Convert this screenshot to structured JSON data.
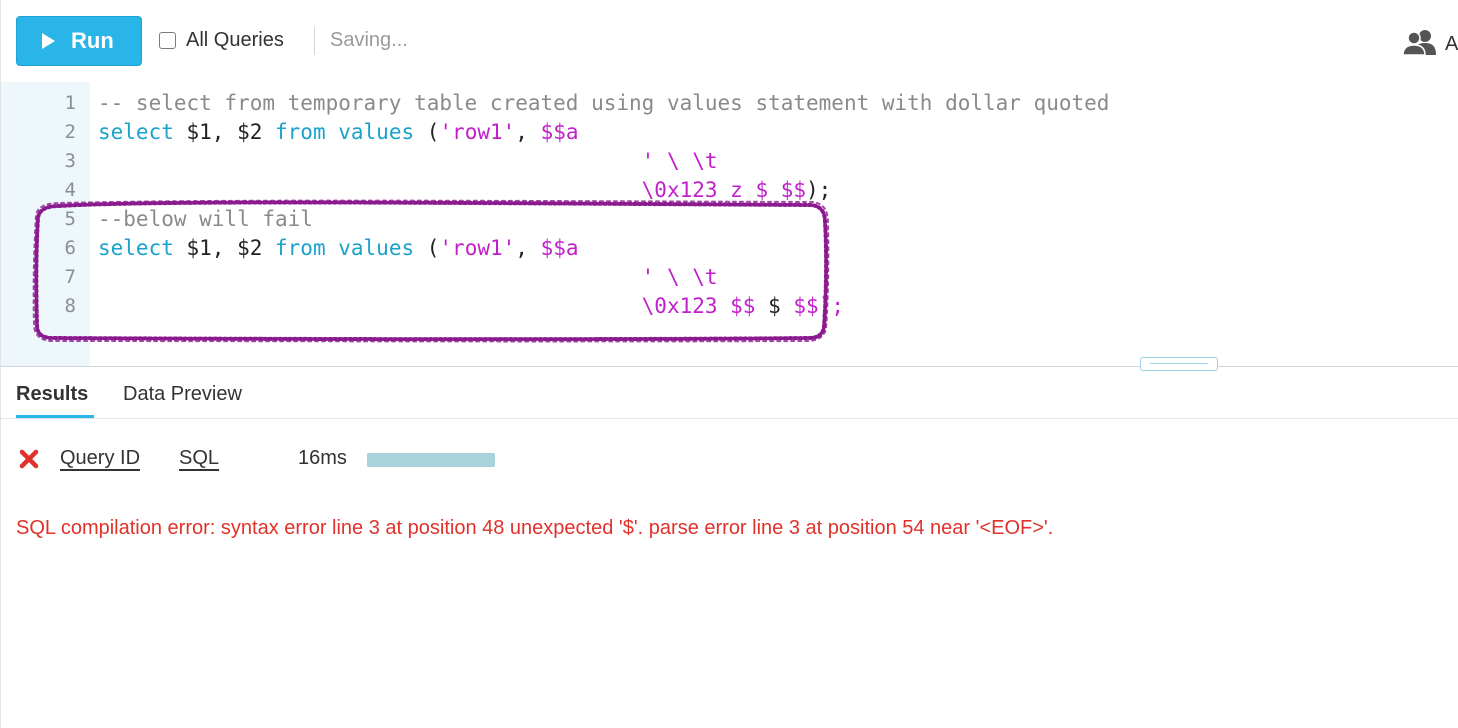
{
  "toolbar": {
    "run_label": "Run",
    "all_queries_label": "All Queries",
    "all_queries_checked": false,
    "status": "Saving...",
    "user_initial": "A",
    "run_icon": "play-icon",
    "user_icon": "users-icon"
  },
  "editor": {
    "lines": [
      {
        "n": "1",
        "tokens": [
          {
            "t": "-- select from temporary table created using values statement with dollar quoted",
            "c": "cm"
          }
        ]
      },
      {
        "n": "2",
        "tokens": [
          {
            "t": "select",
            "c": "kw"
          },
          {
            "t": " $1, $2 ",
            "c": "pl"
          },
          {
            "t": "from",
            "c": "kw"
          },
          {
            "t": " ",
            "c": "pl"
          },
          {
            "t": "values",
            "c": "kw"
          },
          {
            "t": " (",
            "c": "pl"
          },
          {
            "t": "'row1'",
            "c": "st"
          },
          {
            "t": ", ",
            "c": "pl"
          },
          {
            "t": "$$a",
            "c": "st"
          }
        ]
      },
      {
        "n": "3",
        "tokens": [
          {
            "t": "                                           ' \\ \\t",
            "c": "st"
          }
        ]
      },
      {
        "n": "4",
        "tokens": [
          {
            "t": "                                           \\0x123 z $ $$",
            "c": "st"
          },
          {
            "t": ");",
            "c": "pl"
          }
        ]
      },
      {
        "n": "5",
        "tokens": [
          {
            "t": "--below will fail",
            "c": "cm"
          }
        ]
      },
      {
        "n": "6",
        "tokens": [
          {
            "t": "select",
            "c": "kw"
          },
          {
            "t": " $1, $2 ",
            "c": "pl"
          },
          {
            "t": "from",
            "c": "kw"
          },
          {
            "t": " ",
            "c": "pl"
          },
          {
            "t": "values",
            "c": "kw"
          },
          {
            "t": " (",
            "c": "pl"
          },
          {
            "t": "'row1'",
            "c": "st"
          },
          {
            "t": ", ",
            "c": "pl"
          },
          {
            "t": "$$a",
            "c": "st"
          }
        ]
      },
      {
        "n": "7",
        "tokens": [
          {
            "t": "                                           ' \\ \\t",
            "c": "st"
          }
        ]
      },
      {
        "n": "8",
        "tokens": [
          {
            "t": "                                           \\0x123 $$",
            "c": "st"
          },
          {
            "t": " $ ",
            "c": "pl"
          },
          {
            "t": "$$);",
            "c": "st"
          }
        ]
      }
    ]
  },
  "results": {
    "tabs": [
      {
        "label": "Results",
        "active": true
      },
      {
        "label": "Data Preview",
        "active": false
      }
    ],
    "status_icon": "error-x-icon",
    "query_id_label": "Query ID",
    "sql_label": "SQL",
    "duration": "16ms",
    "duration_progress": 1.0,
    "error_message": "SQL compilation error: syntax error line 3 at position 48 unexpected '$'. parse error line 3 at position 54 near '<EOF>'."
  },
  "colors": {
    "accent": "#29b5e8",
    "keyword": "#1aa2cc",
    "string": "#c11fcb",
    "comment": "#8a8a8a",
    "error": "#e0322b",
    "annotation": "#8a1a8e",
    "gutter": "#eef7fb"
  }
}
